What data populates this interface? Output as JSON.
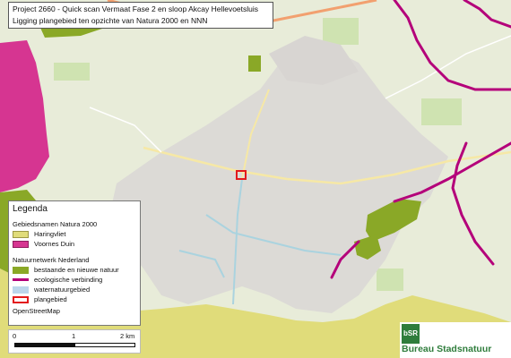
{
  "title": {
    "line1": "Project 2660 - Quick scan Vermaat Fase 2 en sloop Akcay Hellevoetsluis",
    "line2": "Ligging plangebied ten opzichte van Natura 2000 en NNN"
  },
  "legend": {
    "title": "Legenda",
    "groups": [
      {
        "heading": "Gebiedsnamen Natura 2000",
        "items": [
          {
            "label": "Haringvliet",
            "color": "#e0dc7a",
            "kind": "fill"
          },
          {
            "label": "Voornes Duin",
            "color": "#d63591",
            "kind": "fill"
          }
        ]
      },
      {
        "heading": "Natuurnetwerk Nederland",
        "items": [
          {
            "label": "bestaande en nieuwe natuur",
            "color": "#8aa827",
            "kind": "fill"
          },
          {
            "label": "ecologische verbinding",
            "color": "#b4007a",
            "kind": "line"
          },
          {
            "label": "waternatuurgebied",
            "color": "#bcd6ec",
            "kind": "fill"
          },
          {
            "label": "plangebied",
            "color": "#e31a1c",
            "kind": "outline"
          }
        ]
      }
    ],
    "source": "OpenStreetMap"
  },
  "scale": {
    "labels": [
      "0",
      "1",
      "2 km"
    ]
  },
  "logo": {
    "mark": "bSR",
    "name": "Bureau Stadsnatuur"
  },
  "colors": {
    "rural": "#e8ecd9",
    "urban": "#dcdad6",
    "water": "#aad3df",
    "haringvliet": "#e0dc7a",
    "voornes_duin": "#d63591",
    "nnn_natuur": "#8aa827",
    "ecologische_verbinding": "#b4007a",
    "road_major": "#f2a06f",
    "road_secondary": "#f6e8a6",
    "plangebied": "#e31a1c"
  }
}
